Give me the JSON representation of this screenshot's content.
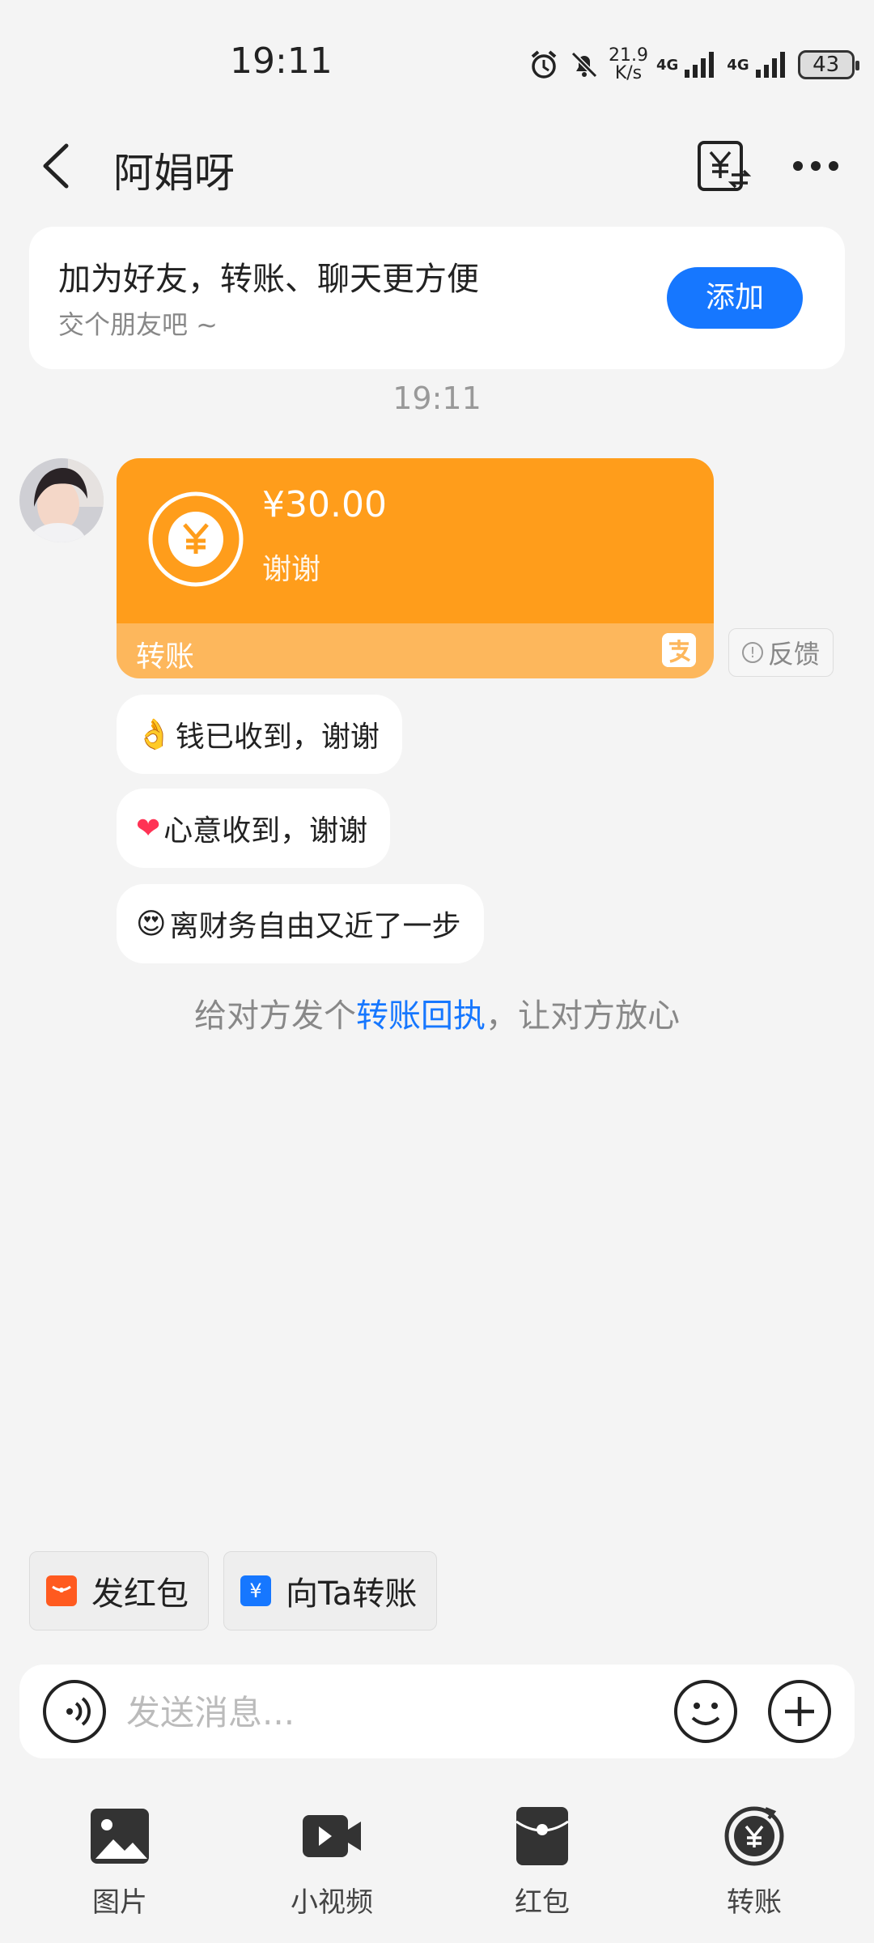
{
  "status_bar": {
    "time": "19:11",
    "net_speed_value": "21.9",
    "net_speed_unit": "K/s",
    "signal1": "4G",
    "signal2": "4G",
    "battery": "43"
  },
  "header": {
    "title": "阿娟呀"
  },
  "friend_card": {
    "title": "加为好友，转账、聊天更方便",
    "subtitle": "交个朋友吧 ~",
    "add_label": "添加"
  },
  "chat": {
    "time_separator": "19:11",
    "transfer": {
      "amount": "¥30.00",
      "note": "谢谢",
      "label": "转账"
    },
    "feedback_label": "反馈",
    "quick_replies": [
      {
        "emoji": "👌",
        "text": "钱已收到，谢谢"
      },
      {
        "emoji": "❤",
        "text": "心意收到，谢谢"
      },
      {
        "emoji": "😍",
        "text": "离财务自由又近了一步"
      }
    ],
    "receipt": {
      "prefix": "给对方发个",
      "link": "转账回执",
      "suffix": "，让对方放心"
    }
  },
  "shortcuts": [
    {
      "label": "发红包",
      "color": "#ff5a1f"
    },
    {
      "label": "向Ta转账",
      "color": "#1677ff"
    }
  ],
  "input": {
    "placeholder": "发送消息..."
  },
  "tools": [
    {
      "label": "图片",
      "icon": "image-icon"
    },
    {
      "label": "小视频",
      "icon": "video-icon"
    },
    {
      "label": "红包",
      "icon": "red-packet-icon"
    },
    {
      "label": "转账",
      "icon": "transfer-icon"
    }
  ]
}
